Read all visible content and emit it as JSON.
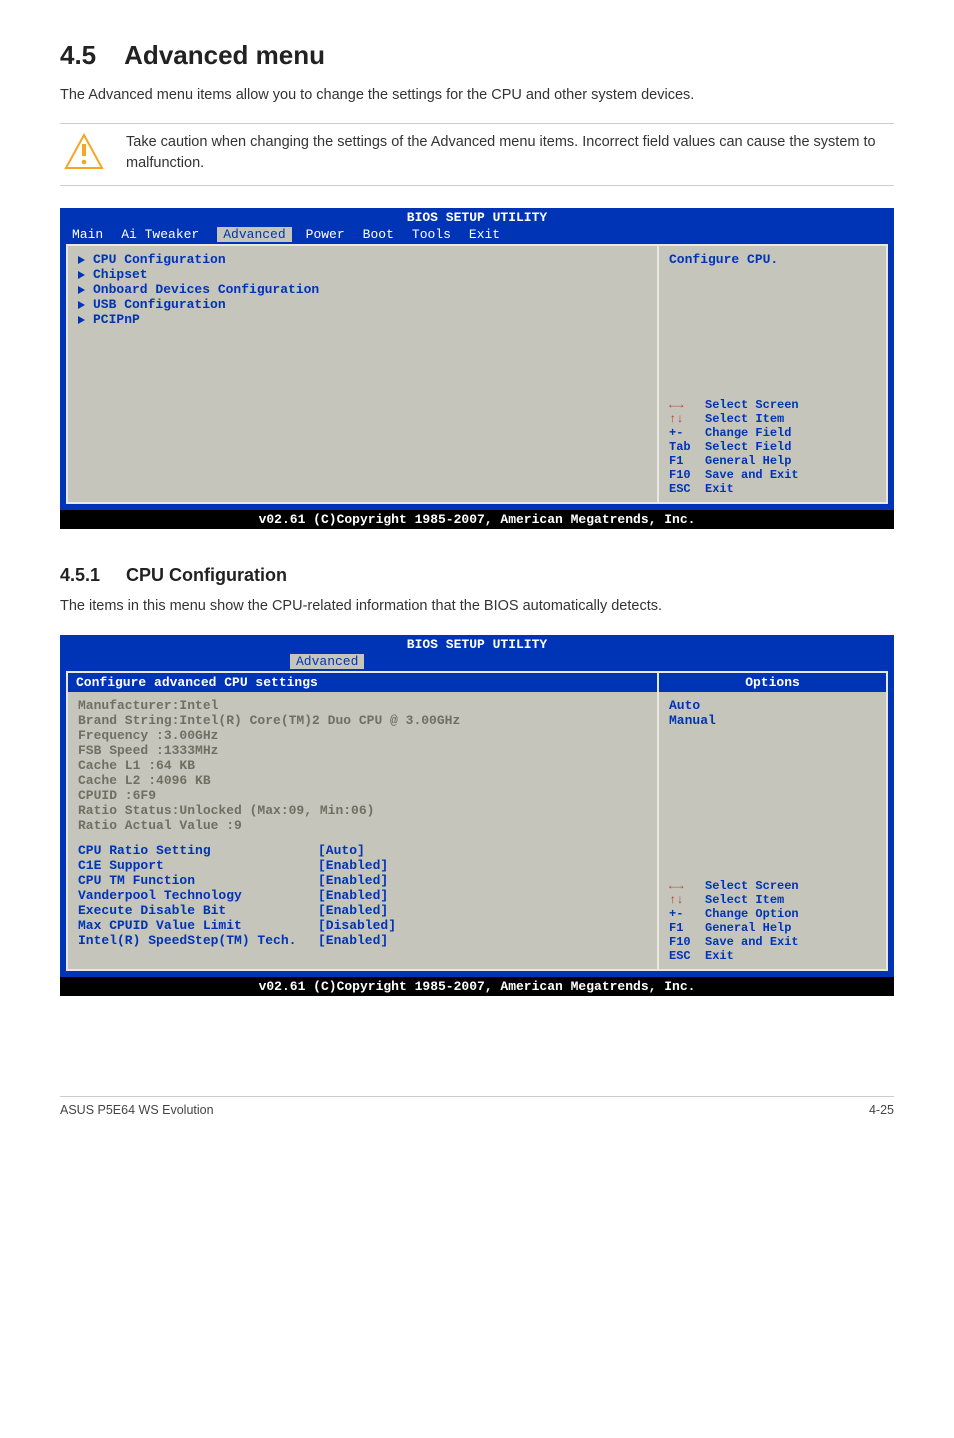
{
  "section": {
    "number": "4.5",
    "title": "Advanced menu"
  },
  "intro": "The Advanced menu items allow you to change the settings for the CPU and other system devices.",
  "caution": "Take caution when changing the settings of the Advanced menu items. Incorrect field values can cause the system to malfunction.",
  "bios1": {
    "header": "BIOS SETUP UTILITY",
    "tabs": [
      "Main",
      "Ai Tweaker",
      "Advanced",
      "Power",
      "Boot",
      "Tools",
      "Exit"
    ],
    "active_tab": "Advanced",
    "items": [
      "CPU Configuration",
      "Chipset",
      "Onboard Devices Configuration",
      "USB Configuration",
      "PCIPnP"
    ],
    "help_top": "Configure CPU.",
    "keys": [
      {
        "k": "←→",
        "v": "Select Screen"
      },
      {
        "k": "↑↓",
        "v": "Select Item"
      },
      {
        "k": "+- ",
        "v": "Change Field"
      },
      {
        "k": "Tab",
        "v": "Select Field"
      },
      {
        "k": "F1 ",
        "v": "General Help"
      },
      {
        "k": "F10",
        "v": "Save and Exit"
      },
      {
        "k": "ESC",
        "v": "Exit"
      }
    ],
    "footer": "v02.61 (C)Copyright 1985-2007, American Megatrends, Inc."
  },
  "subsection": {
    "number": "4.5.1",
    "title": "CPU Configuration"
  },
  "sub_intro": "The items in this menu show the CPU-related information that the BIOS automatically detects.",
  "bios2": {
    "header": "BIOS SETUP UTILITY",
    "active_tab": "Advanced",
    "heading": "Configure advanced CPU settings",
    "info": [
      "Manufacturer:Intel",
      "Brand String:Intel(R) Core(TM)2 Duo CPU @ 3.00GHz",
      "Frequency   :3.00GHz",
      "FSB Speed   :1333MHz",
      "Cache L1    :64 KB",
      "Cache L2    :4096 KB",
      "CPUID       :6F9",
      "Ratio Status:Unlocked (Max:09, Min:06)",
      "Ratio Actual Value  :9"
    ],
    "settings": [
      {
        "k": "CPU Ratio Setting",
        "v": "[Auto]"
      },
      {
        "k": "C1E Support",
        "v": "[Enabled]"
      },
      {
        "k": "CPU TM Function",
        "v": "[Enabled]"
      },
      {
        "k": "Vanderpool Technology",
        "v": "[Enabled]"
      },
      {
        "k": "Execute Disable Bit",
        "v": "[Enabled]"
      },
      {
        "k": "Max CPUID Value Limit",
        "v": "[Disabled]"
      },
      {
        "k": "Intel(R) SpeedStep(TM) Tech.",
        "v": "[Enabled]"
      }
    ],
    "options_title": "Options",
    "options": [
      "Auto",
      "Manual"
    ],
    "keys": [
      {
        "k": "←→",
        "v": "Select Screen"
      },
      {
        "k": "↑↓",
        "v": "Select Item"
      },
      {
        "k": "+- ",
        "v": "Change Option"
      },
      {
        "k": "F1 ",
        "v": "General Help"
      },
      {
        "k": "F10",
        "v": "Save and Exit"
      },
      {
        "k": "ESC",
        "v": "Exit"
      }
    ],
    "footer": "v02.61 (C)Copyright 1985-2007, American Megatrends, Inc."
  },
  "footer": {
    "left": "ASUS P5E64 WS Evolution",
    "right": "4-25"
  }
}
